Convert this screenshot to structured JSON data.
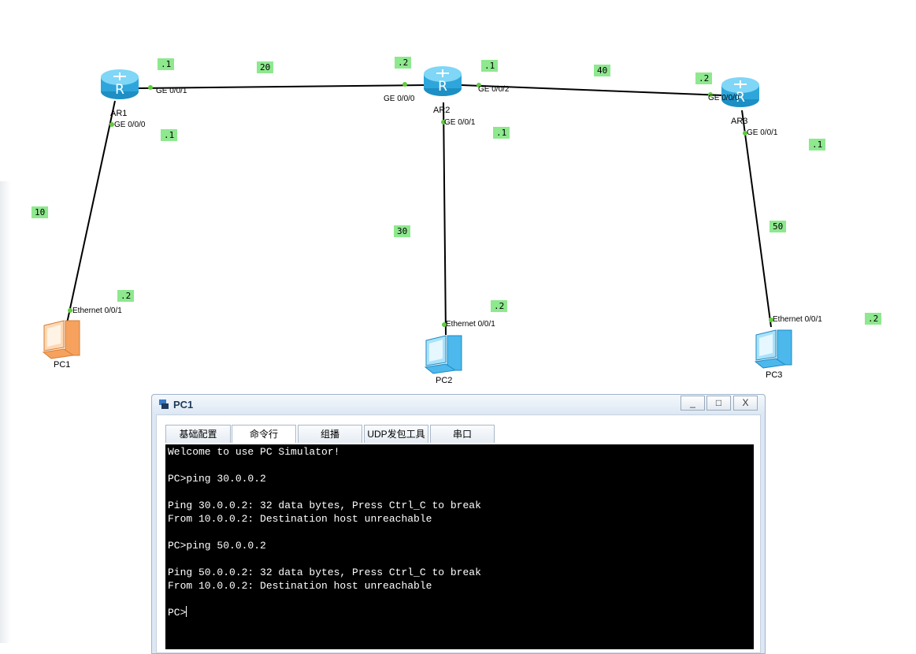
{
  "topology": {
    "devices": [
      {
        "id": "AR1",
        "name": "AR1",
        "kind": "router"
      },
      {
        "id": "AR2",
        "name": "AR2",
        "kind": "router"
      },
      {
        "id": "AR3",
        "name": "AR3",
        "kind": "router"
      },
      {
        "id": "PC1",
        "name": "PC1",
        "kind": "pc-orange"
      },
      {
        "id": "PC2",
        "name": "PC2",
        "kind": "pc-blue"
      },
      {
        "id": "PC3",
        "name": "PC3",
        "kind": "pc-blue"
      }
    ],
    "ports": {
      "ar1_ge001": "GE 0/0/1",
      "ar1_ge000": "GE 0/0/0",
      "ar2_ge000": "GE 0/0/0",
      "ar2_ge002": "GE 0/0/2",
      "ar2_ge001": "GE 0/0/1",
      "ar3_ge000": "GE 0/0/0",
      "ar3_ge001": "GE 0/0/1",
      "pc1_eth": "Ethernet 0/0/1",
      "pc2_eth": "Ethernet 0/0/1",
      "pc3_eth": "Ethernet 0/0/1"
    },
    "labels": {
      "ar1_top": ".1",
      "net20": "20",
      "ar2_left": ".2",
      "ar2_right": ".1",
      "net40": "40",
      "ar3_left": ".2",
      "ar1_down": ".1",
      "net10": "10",
      "pc1_addr": ".2",
      "ar2_down": ".1",
      "net30": "30",
      "pc2_addr": ".2",
      "ar3_down": ".1",
      "net50": "50",
      "pc3_addr": ".2"
    },
    "colors": {
      "label_bg": "#8ee88e",
      "link": "#000000",
      "port_dot": "#5fcc3c",
      "router": "#3fb8e8"
    }
  },
  "window": {
    "title": "PC1",
    "buttons": {
      "minimize": "_",
      "maximize": "□",
      "close": "X"
    },
    "tabs": [
      {
        "label": "基础配置",
        "active": false
      },
      {
        "label": "命令行",
        "active": true
      },
      {
        "label": "组播",
        "active": false
      },
      {
        "label": "UDP发包工具",
        "active": false
      },
      {
        "label": "串口",
        "active": false
      }
    ],
    "console_lines": [
      "Welcome to use PC Simulator!",
      "",
      "PC>ping 30.0.0.2",
      "",
      "Ping 30.0.0.2: 32 data bytes, Press Ctrl_C to break",
      "From 10.0.0.2: Destination host unreachable",
      "",
      "PC>ping 50.0.0.2",
      "",
      "Ping 50.0.0.2: 32 data bytes, Press Ctrl_C to break",
      "From 10.0.0.2: Destination host unreachable",
      ""
    ],
    "prompt": "PC>"
  }
}
